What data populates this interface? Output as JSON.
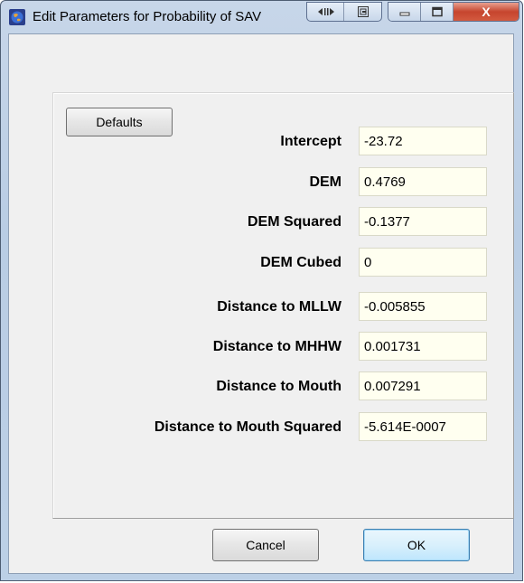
{
  "window": {
    "title": "Edit Parameters for Probability of SAV",
    "close_glyph": "X"
  },
  "buttons": {
    "defaults": "Defaults",
    "cancel": "Cancel",
    "ok": "OK"
  },
  "parameters": [
    {
      "label": "Intercept",
      "value": "-23.72"
    },
    {
      "label": "DEM",
      "value": "0.4769"
    },
    {
      "label": "DEM Squared",
      "value": "-0.1377"
    },
    {
      "label": "DEM Cubed",
      "value": "0"
    },
    {
      "label": "Distance to MLLW",
      "value": "-0.005855"
    },
    {
      "label": "Distance to MHHW",
      "value": "0.001731"
    },
    {
      "label": "Distance to Mouth",
      "value": "0.007291"
    },
    {
      "label": "Distance to Mouth Squared",
      "value": "-5.614E-0007"
    }
  ],
  "colors": {
    "field_background": "#fffff0",
    "close_button": "#c6452e"
  },
  "icons": [
    "globe-icon",
    "resize-icon",
    "restore-icon",
    "minimize-icon",
    "maximize-icon",
    "close-icon"
  ]
}
